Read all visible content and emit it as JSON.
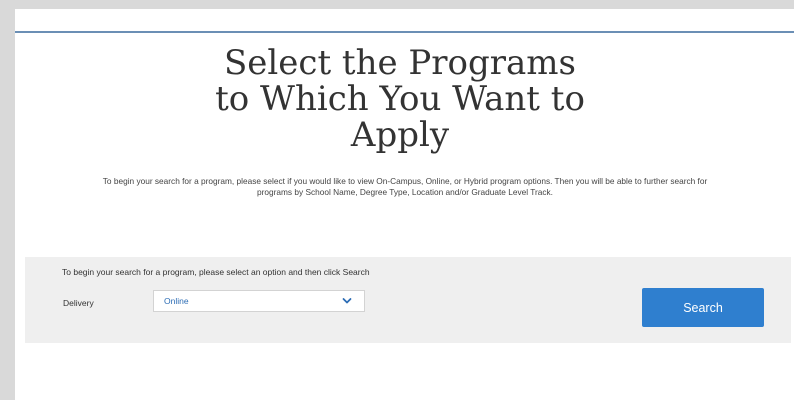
{
  "page": {
    "title_line1": "Select the Programs",
    "title_line2": "to Which You Want to",
    "title_line3": "Apply",
    "intro_line1": "To begin your search for a program, please select if you would like to view On-Campus, Online, or Hybrid program options. Then you will be able to further search for",
    "intro_line2": "programs by School Name, Degree Type, Location and/or Graduate Level Track."
  },
  "search_panel": {
    "instruction": "To begin your search for a program, please select an option and then click Search",
    "delivery_label": "Delivery",
    "delivery_value": "Online",
    "search_label": "Search"
  },
  "icons": {
    "dropdown": "chevron-down-icon"
  },
  "colors": {
    "accent": "#2f7fcf",
    "select_text": "#2d6db5",
    "panel_bg": "#efefef",
    "rule": "#6b8fb5"
  }
}
